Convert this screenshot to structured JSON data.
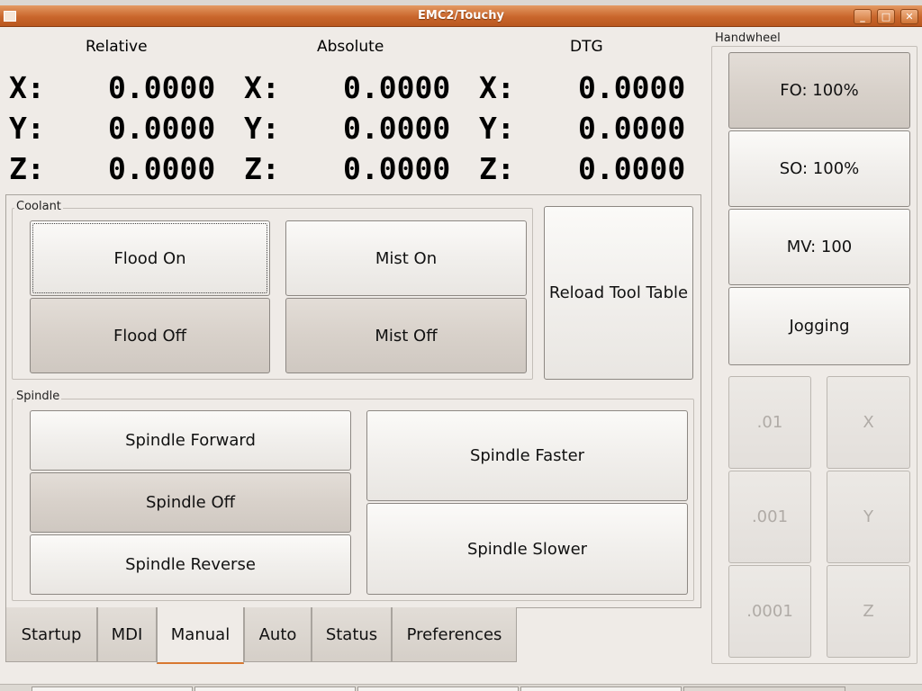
{
  "window": {
    "title": "EMC2/Touchy",
    "minimize_label": "_",
    "maximize_label": "□",
    "close_label": "✕",
    "menu_icon": "window-menu-icon"
  },
  "dro": {
    "headers": {
      "relative": "Relative",
      "absolute": "Absolute",
      "dtg": "DTG"
    },
    "rows": [
      {
        "axis": "X:",
        "relative": "0.0000",
        "absolute": "0.0000",
        "dtg": "0.0000"
      },
      {
        "axis": "Y:",
        "relative": "0.0000",
        "absolute": "0.0000",
        "dtg": "0.0000"
      },
      {
        "axis": "Z:",
        "relative": "0.0000",
        "absolute": "0.0000",
        "dtg": "0.0000"
      }
    ]
  },
  "coolant": {
    "label": "Coolant",
    "flood_on": "Flood On",
    "mist_on": "Mist On",
    "flood_off": "Flood Off",
    "mist_off": "Mist Off"
  },
  "reload_tool_table": "Reload Tool Table",
  "spindle": {
    "label": "Spindle",
    "forward": "Spindle Forward",
    "off": "Spindle Off",
    "reverse": "Spindle Reverse",
    "faster": "Spindle Faster",
    "slower": "Spindle Slower"
  },
  "tabs": [
    "Startup",
    "MDI",
    "Manual",
    "Auto",
    "Status",
    "Preferences"
  ],
  "active_tab": "Manual",
  "handwheel": {
    "label": "Handwheel",
    "fo": "FO: 100%",
    "so": "SO: 100%",
    "mv": "MV: 100",
    "jogging": "Jogging",
    "increments": [
      ".01",
      ".001",
      ".0001"
    ],
    "axes": [
      "X",
      "Y",
      "Z"
    ]
  },
  "colors": {
    "titlebar": "#c9662c",
    "active_tab_underline": "#d8782f"
  }
}
